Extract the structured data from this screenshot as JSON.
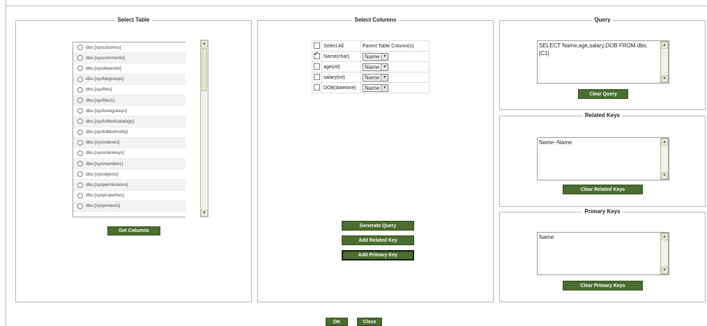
{
  "select_table": {
    "legend": "Select Table",
    "tables": [
      "dbo.[syscolumns]",
      "dbo.[syscomments]",
      "dbo.[sysdepends]",
      "dbo.[sysfilegroups]",
      "dbo.[sysfiles]",
      "dbo.[sysfiles1]",
      "dbo.[sysforeignkeys]",
      "dbo.[sysfulltextcatalogs]",
      "dbo.[sysfulltextnotify]",
      "dbo.[sysindexes]",
      "dbo.[sysindexkeys]",
      "dbo.[sysmembers]",
      "dbo.[sysobjects]",
      "dbo.[syspermissions]",
      "dbo.[sysproperties]",
      "dbo.[sysprotects]"
    ],
    "get_columns": "Get Columns"
  },
  "select_columns": {
    "legend": "Select Columns",
    "select_all": "Select All",
    "parent_header": "Parent Table Column(s)",
    "rows": [
      {
        "name": "Name(char)",
        "checked": true,
        "parent": "Name"
      },
      {
        "name": "age(int)",
        "checked": false,
        "parent": "Name"
      },
      {
        "name": "salary(int)",
        "checked": false,
        "parent": "Name"
      },
      {
        "name": "DOB(datetime)",
        "checked": false,
        "parent": "Name"
      }
    ],
    "generate_query": "Generate Query",
    "add_related_key": "Add Related Key",
    "add_primary_key": "Add Primary Key"
  },
  "query": {
    "legend": "Query",
    "text": "SELECT Name,age,salary,DOB FROM dbo.[C1]",
    "clear": "Clear Query"
  },
  "related_keys": {
    "legend": "Related Keys",
    "text": "Name~Name",
    "clear": "Clear Related Keys"
  },
  "primary_keys": {
    "legend": "Primary Keys",
    "text": "Name",
    "clear": "Clear Primary Keys"
  },
  "footer": {
    "ok": "OK",
    "close": "Close"
  },
  "colors": {
    "button_bg": "#4a6e2e",
    "border": "#b3b3b3"
  }
}
